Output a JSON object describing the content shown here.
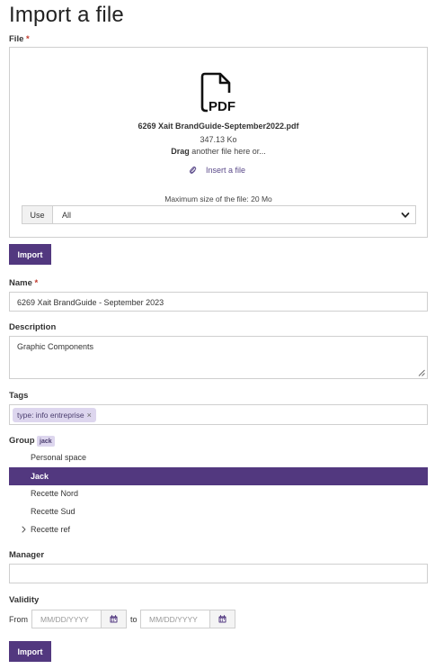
{
  "page": {
    "title": "Import a file"
  },
  "file": {
    "label": "File",
    "required_mark": "*",
    "file_type_badge": "PDF",
    "file_name": "6269 Xait BrandGuide-September2022.pdf",
    "file_size": "347.13 Ko",
    "drag_bold": "Drag",
    "drag_rest": " another file here or...",
    "insert_label": "Insert a file",
    "max_size": "Maximum size of the file: 20 Mo",
    "use_label": "Use",
    "use_value": "All"
  },
  "import_button_1": "Import",
  "name": {
    "label": "Name",
    "required_mark": "*",
    "value": "6269 Xait BrandGuide - September 2023"
  },
  "description": {
    "label": "Description",
    "value": "Graphic Components"
  },
  "tags": {
    "label": "Tags",
    "items": [
      {
        "text": "type: info entreprise",
        "remove": "×"
      }
    ]
  },
  "group": {
    "label": "Group",
    "badge": "jack",
    "items": [
      {
        "label": "Personal space",
        "selected": false,
        "expandable": false
      },
      {
        "label": "Jack",
        "selected": true,
        "expandable": false
      },
      {
        "label": "Recette Nord",
        "selected": false,
        "expandable": false
      },
      {
        "label": "Recette Sud",
        "selected": false,
        "expandable": false
      },
      {
        "label": "Recette ref",
        "selected": false,
        "expandable": true
      }
    ]
  },
  "manager": {
    "label": "Manager",
    "value": ""
  },
  "validity": {
    "label": "Validity",
    "from_label": "From",
    "to_label": "to",
    "from_placeholder": "MM/DD/YYYY",
    "to_placeholder": "MM/DD/YYYY"
  },
  "import_button_2": "Import",
  "colors": {
    "accent": "#52387f",
    "tag_bg": "#ddd6ee",
    "required": "#c0392b"
  },
  "icons": [
    "pdf-file-icon",
    "paperclip-icon",
    "chevron-down-icon",
    "resize-handle-icon",
    "tag-remove-icon",
    "chevron-right-icon",
    "calendar-icon"
  ]
}
